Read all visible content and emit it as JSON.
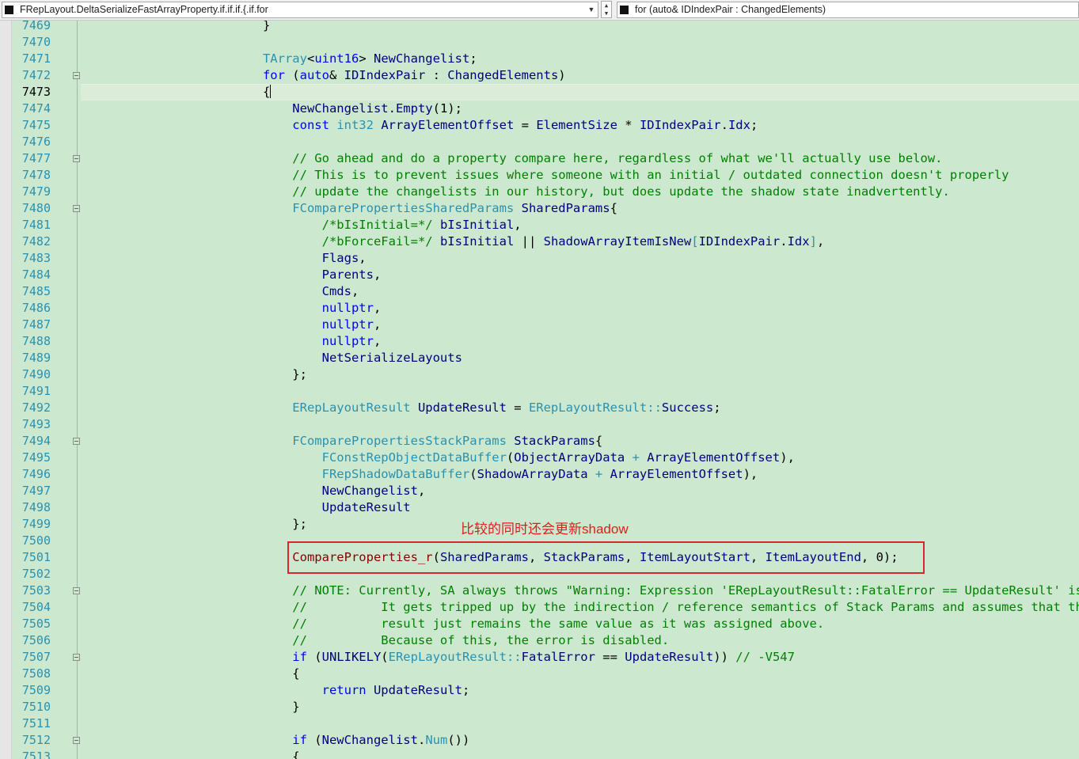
{
  "navigation": {
    "scope_value": "FRepLayout.DeltaSerializeFastArrayProperty.if.if.if.{.if.for",
    "member_value": "for (auto& IDIndexPair : ChangedElements)"
  },
  "annotation": {
    "text": "比较的同时还会更新shadow"
  },
  "editor": {
    "current_line": "7473",
    "lines": [
      {
        "n": "7469",
        "fold": false,
        "t": [
          [
            "pun",
            "                        }"
          ]
        ]
      },
      {
        "n": "7470",
        "fold": false,
        "t": []
      },
      {
        "n": "7471",
        "fold": false,
        "t": [
          [
            "pun",
            "                        "
          ],
          [
            "ty",
            "TArray"
          ],
          [
            "pun",
            "<"
          ],
          [
            "kw",
            "uint16"
          ],
          [
            "pun",
            "> "
          ],
          [
            "id",
            "NewChangelist"
          ],
          [
            "pun",
            ";"
          ]
        ]
      },
      {
        "n": "7472",
        "fold": true,
        "t": [
          [
            "pun",
            "                        "
          ],
          [
            "kw",
            "for"
          ],
          [
            "pun",
            " ("
          ],
          [
            "kw",
            "auto"
          ],
          [
            "pun",
            "& "
          ],
          [
            "id",
            "IDIndexPair"
          ],
          [
            "pun",
            " : "
          ],
          [
            "id",
            "ChangedElements"
          ],
          [
            "pun",
            ")"
          ]
        ]
      },
      {
        "n": "7473",
        "fold": false,
        "t": [
          [
            "pun",
            "                        {"
          ]
        ]
      },
      {
        "n": "7474",
        "fold": false,
        "t": [
          [
            "pun",
            "                            "
          ],
          [
            "id",
            "NewChangelist"
          ],
          [
            "pun",
            "."
          ],
          [
            "id",
            "Empty"
          ],
          [
            "pun",
            "(1);"
          ]
        ]
      },
      {
        "n": "7475",
        "fold": false,
        "t": [
          [
            "pun",
            "                            "
          ],
          [
            "kw",
            "const"
          ],
          [
            "pun",
            " "
          ],
          [
            "ty",
            "int32"
          ],
          [
            "pun",
            " "
          ],
          [
            "id",
            "ArrayElementOffset"
          ],
          [
            "pun",
            " = "
          ],
          [
            "id",
            "ElementSize"
          ],
          [
            "pun",
            " * "
          ],
          [
            "id",
            "IDIndexPair"
          ],
          [
            "pun",
            "."
          ],
          [
            "id",
            "Idx"
          ],
          [
            "pun",
            ";"
          ]
        ]
      },
      {
        "n": "7476",
        "fold": false,
        "t": []
      },
      {
        "n": "7477",
        "fold": true,
        "t": [
          [
            "pun",
            "                            "
          ],
          [
            "cm",
            "// Go ahead and do a property compare here, regardless of what we'll actually use below."
          ]
        ]
      },
      {
        "n": "7478",
        "fold": false,
        "t": [
          [
            "pun",
            "                            "
          ],
          [
            "cm",
            "// This is to prevent issues where someone with an initial / outdated connection doesn't properly"
          ]
        ]
      },
      {
        "n": "7479",
        "fold": false,
        "t": [
          [
            "pun",
            "                            "
          ],
          [
            "cm",
            "// update the changelists in our history, but does update the shadow state inadvertently."
          ]
        ]
      },
      {
        "n": "7480",
        "fold": true,
        "t": [
          [
            "pun",
            "                            "
          ],
          [
            "ty",
            "FComparePropertiesSharedParams"
          ],
          [
            "pun",
            " "
          ],
          [
            "id",
            "SharedParams"
          ],
          [
            "pun",
            "{"
          ]
        ]
      },
      {
        "n": "7481",
        "fold": false,
        "t": [
          [
            "pun",
            "                                "
          ],
          [
            "cm",
            "/*bIsInitial=*/"
          ],
          [
            "pun",
            " "
          ],
          [
            "id",
            "bIsInitial"
          ],
          [
            "pun",
            ","
          ]
        ]
      },
      {
        "n": "7482",
        "fold": false,
        "t": [
          [
            "pun",
            "                                "
          ],
          [
            "cm",
            "/*bForceFail=*/"
          ],
          [
            "pun",
            " "
          ],
          [
            "id",
            "bIsInitial"
          ],
          [
            "pun",
            " || "
          ],
          [
            "id",
            "ShadowArrayItemIsNew"
          ],
          [
            "ty",
            "["
          ],
          [
            "id",
            "IDIndexPair"
          ],
          [
            "pun",
            "."
          ],
          [
            "id",
            "Idx"
          ],
          [
            "ty",
            "]"
          ],
          [
            "pun",
            ","
          ]
        ]
      },
      {
        "n": "7483",
        "fold": false,
        "t": [
          [
            "pun",
            "                                "
          ],
          [
            "id",
            "Flags"
          ],
          [
            "pun",
            ","
          ]
        ]
      },
      {
        "n": "7484",
        "fold": false,
        "t": [
          [
            "pun",
            "                                "
          ],
          [
            "id",
            "Parents"
          ],
          [
            "pun",
            ","
          ]
        ]
      },
      {
        "n": "7485",
        "fold": false,
        "t": [
          [
            "pun",
            "                                "
          ],
          [
            "id",
            "Cmds"
          ],
          [
            "pun",
            ","
          ]
        ]
      },
      {
        "n": "7486",
        "fold": false,
        "t": [
          [
            "pun",
            "                                "
          ],
          [
            "kw",
            "nullptr"
          ],
          [
            "pun",
            ","
          ]
        ]
      },
      {
        "n": "7487",
        "fold": false,
        "t": [
          [
            "pun",
            "                                "
          ],
          [
            "kw",
            "nullptr"
          ],
          [
            "pun",
            ","
          ]
        ]
      },
      {
        "n": "7488",
        "fold": false,
        "t": [
          [
            "pun",
            "                                "
          ],
          [
            "kw",
            "nullptr"
          ],
          [
            "pun",
            ","
          ]
        ]
      },
      {
        "n": "7489",
        "fold": false,
        "t": [
          [
            "pun",
            "                                "
          ],
          [
            "id",
            "NetSerializeLayouts"
          ]
        ]
      },
      {
        "n": "7490",
        "fold": false,
        "t": [
          [
            "pun",
            "                            };"
          ]
        ]
      },
      {
        "n": "7491",
        "fold": false,
        "t": []
      },
      {
        "n": "7492",
        "fold": false,
        "t": [
          [
            "pun",
            "                            "
          ],
          [
            "ty",
            "ERepLayoutResult"
          ],
          [
            "pun",
            " "
          ],
          [
            "id",
            "UpdateResult"
          ],
          [
            "pun",
            " = "
          ],
          [
            "ty",
            "ERepLayoutResult"
          ],
          [
            "ty",
            "::"
          ],
          [
            "id",
            "Success"
          ],
          [
            "pun",
            ";"
          ]
        ]
      },
      {
        "n": "7493",
        "fold": false,
        "t": []
      },
      {
        "n": "7494",
        "fold": true,
        "t": [
          [
            "pun",
            "                            "
          ],
          [
            "ty",
            "FComparePropertiesStackParams"
          ],
          [
            "pun",
            " "
          ],
          [
            "id",
            "StackParams"
          ],
          [
            "pun",
            "{"
          ]
        ]
      },
      {
        "n": "7495",
        "fold": false,
        "t": [
          [
            "pun",
            "                                "
          ],
          [
            "ty",
            "FConstRepObjectDataBuffer"
          ],
          [
            "pun",
            "("
          ],
          [
            "id",
            "ObjectArrayData"
          ],
          [
            "ty",
            " + "
          ],
          [
            "id",
            "ArrayElementOffset"
          ],
          [
            "pun",
            "),"
          ]
        ]
      },
      {
        "n": "7496",
        "fold": false,
        "t": [
          [
            "pun",
            "                                "
          ],
          [
            "ty",
            "FRepShadowDataBuffer"
          ],
          [
            "pun",
            "("
          ],
          [
            "id",
            "ShadowArrayData"
          ],
          [
            "ty",
            " + "
          ],
          [
            "id",
            "ArrayElementOffset"
          ],
          [
            "pun",
            "),"
          ]
        ]
      },
      {
        "n": "7497",
        "fold": false,
        "t": [
          [
            "pun",
            "                                "
          ],
          [
            "id",
            "NewChangelist"
          ],
          [
            "pun",
            ","
          ]
        ]
      },
      {
        "n": "7498",
        "fold": false,
        "t": [
          [
            "pun",
            "                                "
          ],
          [
            "id",
            "UpdateResult"
          ]
        ]
      },
      {
        "n": "7499",
        "fold": false,
        "t": [
          [
            "pun",
            "                            };"
          ]
        ]
      },
      {
        "n": "7500",
        "fold": false,
        "t": []
      },
      {
        "n": "7501",
        "fold": false,
        "t": [
          [
            "pun",
            "                            "
          ],
          [
            "fn",
            "CompareProperties_r"
          ],
          [
            "pun",
            "("
          ],
          [
            "id",
            "SharedParams"
          ],
          [
            "pun",
            ", "
          ],
          [
            "id",
            "StackParams"
          ],
          [
            "pun",
            ", "
          ],
          [
            "id",
            "ItemLayoutStart"
          ],
          [
            "pun",
            ", "
          ],
          [
            "id",
            "ItemLayoutEnd"
          ],
          [
            "pun",
            ", 0);"
          ]
        ]
      },
      {
        "n": "7502",
        "fold": false,
        "t": []
      },
      {
        "n": "7503",
        "fold": true,
        "t": [
          [
            "pun",
            "                            "
          ],
          [
            "cm",
            "// NOTE: Currently, SA always throws \"Warning: Expression 'ERepLayoutResult::FatalError == UpdateResult' is always false."
          ]
        ]
      },
      {
        "n": "7504",
        "fold": false,
        "t": [
          [
            "pun",
            "                            "
          ],
          [
            "cm",
            "//          It gets tripped up by the indirection / reference semantics of Stack Params and assumes that the"
          ]
        ]
      },
      {
        "n": "7505",
        "fold": false,
        "t": [
          [
            "pun",
            "                            "
          ],
          [
            "cm",
            "//          result just remains the same value as it was assigned above."
          ]
        ]
      },
      {
        "n": "7506",
        "fold": false,
        "t": [
          [
            "pun",
            "                            "
          ],
          [
            "cm",
            "//          Because of this, the error is disabled."
          ]
        ]
      },
      {
        "n": "7507",
        "fold": true,
        "t": [
          [
            "pun",
            "                            "
          ],
          [
            "kw",
            "if"
          ],
          [
            "pun",
            " ("
          ],
          [
            "id",
            "UNLIKELY"
          ],
          [
            "pun",
            "("
          ],
          [
            "ty",
            "ERepLayoutResult"
          ],
          [
            "ty",
            "::"
          ],
          [
            "id",
            "FatalError"
          ],
          [
            "pun",
            " == "
          ],
          [
            "id",
            "UpdateResult"
          ],
          [
            "pun",
            "))"
          ],
          [
            "pun",
            " "
          ],
          [
            "cm",
            "// -V547"
          ]
        ]
      },
      {
        "n": "7508",
        "fold": false,
        "t": [
          [
            "pun",
            "                            {"
          ]
        ]
      },
      {
        "n": "7509",
        "fold": false,
        "t": [
          [
            "pun",
            "                                "
          ],
          [
            "kw",
            "return"
          ],
          [
            "pun",
            " "
          ],
          [
            "id",
            "UpdateResult"
          ],
          [
            "pun",
            ";"
          ]
        ]
      },
      {
        "n": "7510",
        "fold": false,
        "t": [
          [
            "pun",
            "                            }"
          ]
        ]
      },
      {
        "n": "7511",
        "fold": false,
        "t": []
      },
      {
        "n": "7512",
        "fold": true,
        "t": [
          [
            "pun",
            "                            "
          ],
          [
            "kw",
            "if"
          ],
          [
            "pun",
            " ("
          ],
          [
            "id",
            "NewChangelist"
          ],
          [
            "pun",
            "."
          ],
          [
            "ty",
            "Num"
          ],
          [
            "pun",
            "())"
          ]
        ]
      },
      {
        "n": "7513",
        "fold": false,
        "t": [
          [
            "pun",
            "                            {"
          ]
        ]
      }
    ]
  }
}
